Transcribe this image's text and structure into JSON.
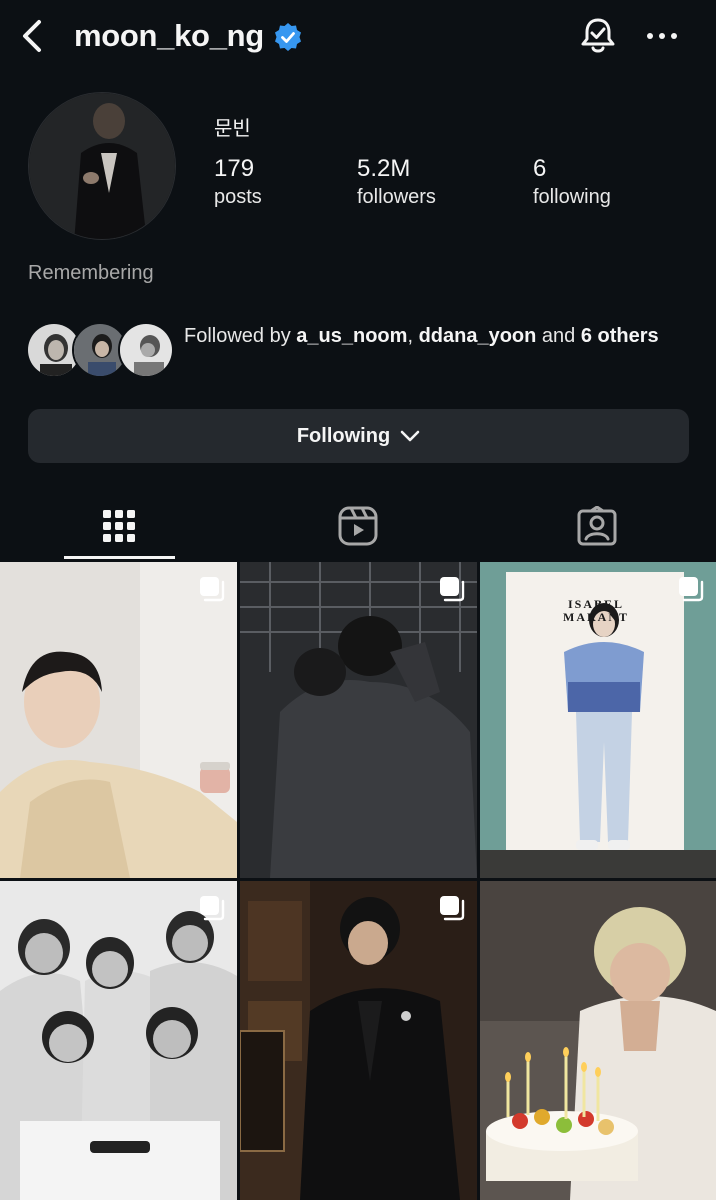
{
  "header": {
    "username": "moon_ko_ng",
    "icons": {
      "back": "chevron-left-icon",
      "verified": "verified-badge-icon",
      "notify": "bell-check-icon",
      "more": "more-dots-icon"
    }
  },
  "profile": {
    "display_name": "문빈",
    "stats": [
      {
        "value": "179",
        "label": "posts"
      },
      {
        "value": "5.2M",
        "label": "followers"
      },
      {
        "value": "6",
        "label": "following"
      }
    ],
    "bio": "Remembering"
  },
  "followed_by": {
    "prefix": "Followed by ",
    "user1": "a_us_noom",
    "sep": ", ",
    "user2": "ddana_yoon",
    "mid": " and ",
    "others": "6 others"
  },
  "following_button": {
    "label": "Following"
  },
  "tabs": [
    {
      "name": "posts",
      "icon": "grid-icon",
      "active": true
    },
    {
      "name": "reels",
      "icon": "reels-icon",
      "active": false
    },
    {
      "name": "tagged",
      "icon": "tagged-person-icon",
      "active": false
    }
  ],
  "colors": {
    "background": "#0c1014",
    "button": "#25292e",
    "verified": "#3797f0",
    "muted": "#a8a8a8"
  },
  "posts": [
    {
      "desc": "man in beige outfit holding cosmetic jar",
      "multi": true
    },
    {
      "desc": "two people embracing backstage",
      "multi": true
    },
    {
      "desc": "man at Isabel Marant event",
      "multi": true,
      "sign_text": "ISABEL MARANT"
    },
    {
      "desc": "group photo of five members in white shirts",
      "multi": true
    },
    {
      "desc": "man in black suit with brooch",
      "multi": true
    },
    {
      "desc": "person making a wish over birthday cake",
      "multi": false
    }
  ]
}
